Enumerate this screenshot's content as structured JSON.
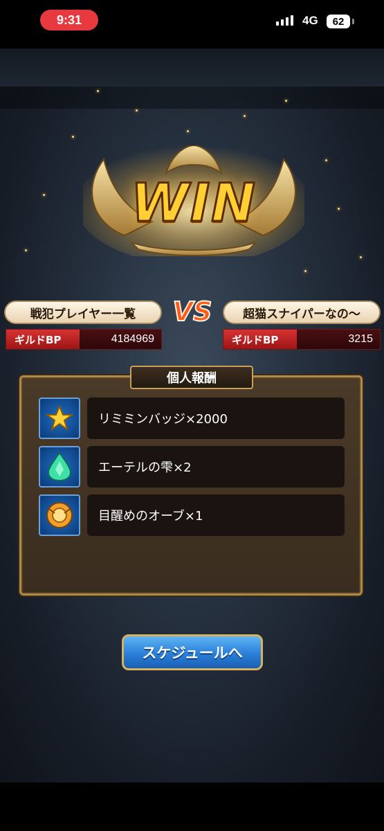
{
  "status_bar": {
    "time": "9:31",
    "network": "4G",
    "battery": "62"
  },
  "result": {
    "title": "WIN",
    "vs": "VS"
  },
  "left_guild": {
    "name": "戦犯プレイヤー一覧",
    "bp_label": "ギルドBP",
    "bp_value": "4184969"
  },
  "right_guild": {
    "name": "超猫スナイパーなの〜",
    "bp_label": "ギルドBP",
    "bp_value": "3215"
  },
  "rewards_panel": {
    "title": "個人報酬",
    "items": [
      {
        "label": "リミミンバッジ×2000",
        "icon": "star-badge-icon"
      },
      {
        "label": "エーテルの雫×2",
        "icon": "ether-drop-icon"
      },
      {
        "label": "目醒めのオーブ×1",
        "icon": "awakening-orb-icon"
      }
    ]
  },
  "buttons": {
    "schedule": "スケジュールへ"
  }
}
